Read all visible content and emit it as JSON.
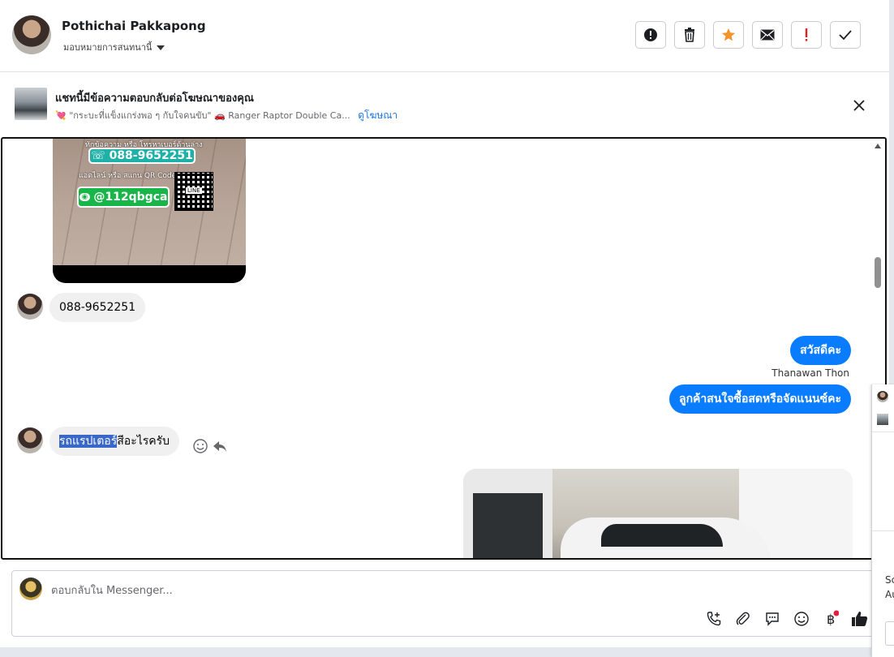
{
  "header": {
    "name": "Pothichai Pakkapong",
    "assign_label": "มอบหมายการสนทนานี้",
    "actions": [
      "mark-spam-icon",
      "trash-icon",
      "star-icon",
      "envelope-icon",
      "exclamation-icon",
      "check-icon"
    ]
  },
  "banner": {
    "title": "แชทนี้มีข้อความตอบกลับต่อโฆษณาของคุณ",
    "ad_quote": "💘 \"กระบะที่แข็งแกร่งพอ ๆ กับใจคนขับ\"",
    "ad_name": "🚗 Ranger Raptor Double Ca...",
    "view_ad": "ดูโฆษณา"
  },
  "messages": {
    "ad_image": {
      "caption_top": "ทักข้อความ หรือ โทรหาเบอร์ด้านล่าง",
      "phone": "088-9652251",
      "caption_line": "แอดไลน์ หรือ สแกน QR Code",
      "line_id": "@112qbgca",
      "qr_label": "LINE"
    },
    "m1": "088-9652251",
    "m2": "สวัสดีคะ",
    "agent_name": "Thanawan Thon",
    "m3": "ลูกค้าสนใจซื้อสดหรือจัดแนนซ์คะ",
    "m4_selected": "รถแรปเตอร์",
    "m4_rest": "สีอะไรครับ"
  },
  "composer": {
    "placeholder": "ตอบกลับใน Messenger...",
    "tools": [
      "phone-plus-icon",
      "paperclip-icon",
      "chat-bubble-icon",
      "emoji-icon",
      "baht-icon",
      "thumbs-up-icon"
    ]
  },
  "side_panel": {
    "text1": "Sc",
    "text2": "Au"
  },
  "colors": {
    "accent": "#0a7cff",
    "link": "#1b74e4",
    "incoming_bubble": "#f0f0f0",
    "star": "#f5922b",
    "warning_red": "#e02020"
  }
}
